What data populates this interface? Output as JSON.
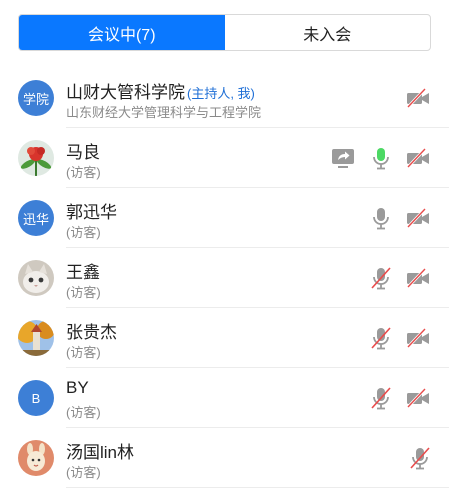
{
  "tabs": [
    {
      "label": "会议中(7)",
      "active": true
    },
    {
      "label": "未入会",
      "active": false
    }
  ],
  "participants": [
    {
      "name": "山财大管科学院",
      "tag": "(主持人, 我)",
      "sub": "山东财经大学管理科学与工程学院",
      "avatar_text": "学院",
      "avatar_kind": "text",
      "mic": "none",
      "share": false,
      "camera": "off"
    },
    {
      "name": "马良",
      "tag": "",
      "sub": "(访客)",
      "avatar_text": "",
      "avatar_kind": "flower",
      "mic": "speaking",
      "share": true,
      "camera": "off"
    },
    {
      "name": "郭迅华",
      "tag": "",
      "sub": "(访客)",
      "avatar_text": "迅华",
      "avatar_kind": "text",
      "mic": "on",
      "share": false,
      "camera": "off"
    },
    {
      "name": "王鑫",
      "tag": "",
      "sub": "(访客)",
      "avatar_text": "",
      "avatar_kind": "cat",
      "mic": "muted",
      "share": false,
      "camera": "off"
    },
    {
      "name": "张贵杰",
      "tag": "",
      "sub": "(访客)",
      "avatar_text": "",
      "avatar_kind": "autumn",
      "mic": "muted",
      "share": false,
      "camera": "off"
    },
    {
      "name": "BY",
      "tag": "",
      "sub": "(访客)",
      "avatar_text": "B",
      "avatar_kind": "text",
      "mic": "muted",
      "share": false,
      "camera": "off"
    },
    {
      "name": "汤国lin林",
      "tag": "",
      "sub": "(访客)",
      "avatar_text": "",
      "avatar_kind": "cartoon",
      "mic": "muted",
      "share": false,
      "camera": "none"
    }
  ],
  "colors": {
    "accent": "#0a78ff",
    "host_tag": "#1f6fd6",
    "avatar_bg": "#3d7fd6",
    "speaking": "#4cd964",
    "muted_slash": "#e84c4c",
    "icon_gray": "#9a9a9a"
  },
  "icons": {
    "share": "screen-share-icon",
    "mic_on": "microphone-icon",
    "mic_muted": "microphone-muted-icon",
    "camera_off": "camera-off-icon"
  }
}
